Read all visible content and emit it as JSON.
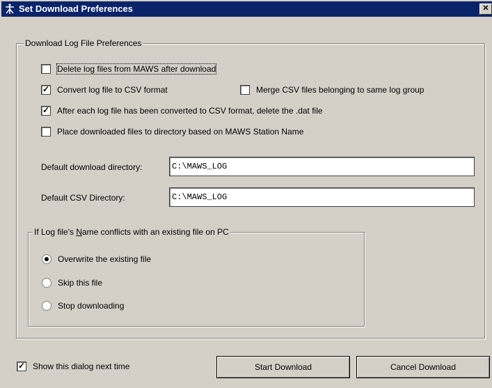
{
  "window": {
    "title": "Set Download Preferences",
    "close_label": "✕",
    "app_icon": "maws-icon"
  },
  "log_prefs": {
    "legend": "Download Log File Preferences",
    "delete_log": {
      "label": "Delete log files from MAWS after download",
      "checked": false
    },
    "convert_csv": {
      "label": "Convert log file to CSV format",
      "checked": true
    },
    "merge_csv": {
      "label": "Merge CSV files belonging to same log group",
      "checked": false
    },
    "delete_dat": {
      "label": "After each log file has been converted to CSV format, delete the .dat file",
      "checked": true
    },
    "place_by_station": {
      "label": "Place downloaded files to directory based on MAWS Station Name",
      "checked": false
    },
    "download_dir": {
      "label": "Default download directory:",
      "value": "C:\\MAWS_LOG"
    },
    "csv_dir": {
      "label": "Default CSV Directory:",
      "value": "C:\\MAWS_LOG"
    }
  },
  "conflict": {
    "legend_pre": "If Log file's ",
    "legend_u": "N",
    "legend_post": "ame conflicts with an existing file on PC",
    "options": [
      {
        "label": "Overwrite the existing file",
        "selected": true
      },
      {
        "label": "Skip this file",
        "selected": false
      },
      {
        "label": "Stop downloading",
        "selected": false
      }
    ]
  },
  "footer": {
    "show_dialog": {
      "label": "Show this dialog next time",
      "checked": true
    },
    "start_button": "Start Download",
    "cancel_button": "Cancel Download"
  }
}
